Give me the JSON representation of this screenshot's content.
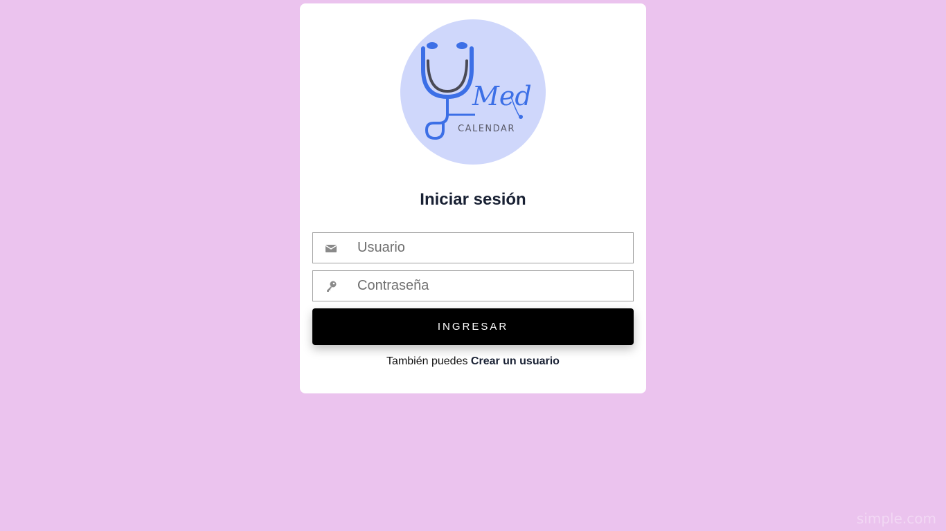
{
  "logo": {
    "script_text": "Med",
    "caption": "CALENDAR",
    "colors": {
      "circle": "#CFD7FB",
      "stethoscope": "#3C6FE6",
      "tubing_dark": "#4A4A55"
    }
  },
  "login": {
    "title": "Iniciar sesión",
    "username_placeholder": "Usuario",
    "username_icon": "envelope-icon",
    "password_placeholder": "Contraseña",
    "password_icon": "key-icon",
    "submit_label": "INGRESAR",
    "footer_prefix": "También puedes",
    "footer_link": "Crear un usuario"
  },
  "watermark": "simple.com",
  "colors": {
    "background": "#EBC3EE",
    "card": "#FFFFFF",
    "button": "#000000",
    "title": "#182033"
  }
}
